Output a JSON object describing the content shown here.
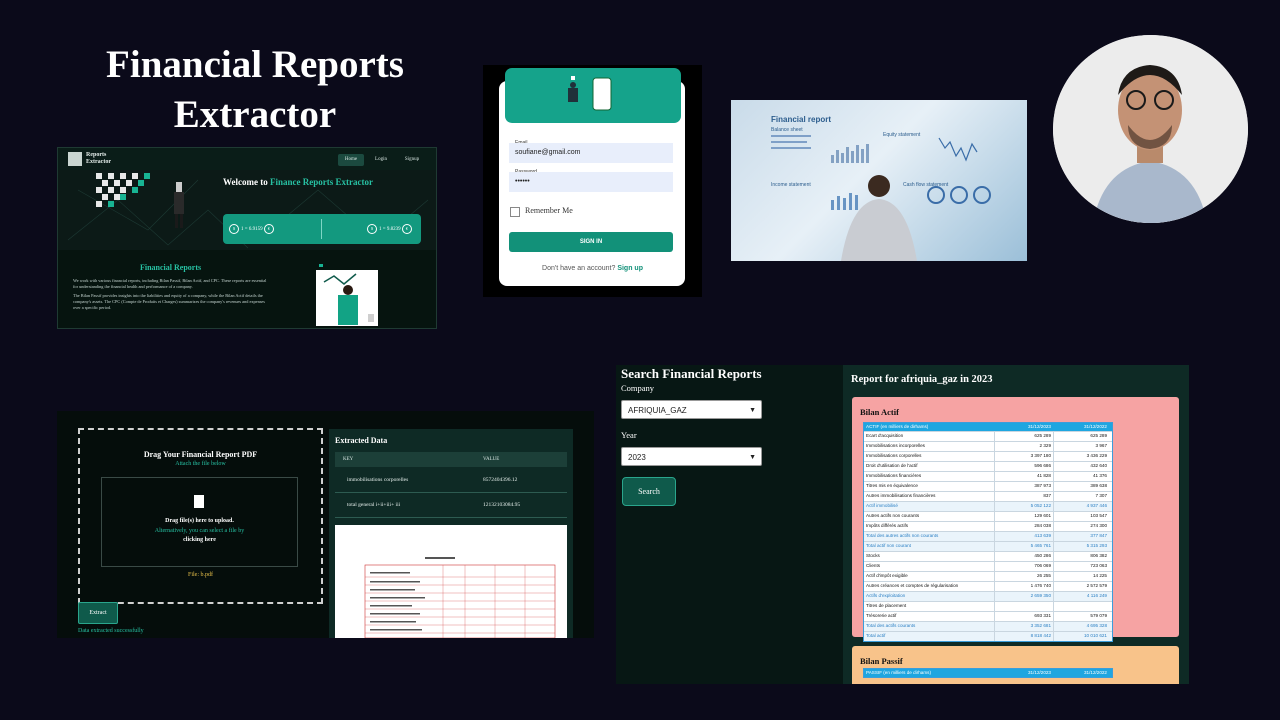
{
  "title_line1": "Financial Reports",
  "title_line2": "Extractor",
  "landing": {
    "brand_line1": "Reports",
    "brand_line2": "Extractor",
    "nav": [
      "Home",
      "Login",
      "Signup"
    ],
    "welcome_prefix": "Welcome to",
    "welcome_brand": "Finance Reports Extractor",
    "rate1": "1 = 6.9159",
    "rate2": "1 = 9.8239",
    "rate1_symbol": "$",
    "rate1_symbol2": "€",
    "rate2_symbol": "$",
    "rate2_symbol2": "€",
    "section_title": "Financial Reports",
    "para1": "We work with various financial reports, including Bilan Passif, Bilan Actif, and CPC. These reports are essential for understanding the financial health and performance of a company.",
    "para2": "The Bilan Passif provides insights into the liabilities and equity of a company, while the Bilan Actif details the company's assets. The CPC (Compte de Produits et Charges) summarizes the company's revenues and expenses over a specific period."
  },
  "login": {
    "email_label": "Email",
    "email_value": "soufiane@gmail.com",
    "password_label": "Password",
    "password_value": "••••••",
    "remember": "Remember Me",
    "sign_in": "SIGN IN",
    "no_account": "Don't have an account?",
    "sign_up": "Sign up"
  },
  "photo": {
    "report_title": "Financial report",
    "balance_sheet": "Balance sheet",
    "equity_statement": "Equity statement",
    "income_statement": "Income statement",
    "cash_flow": "Cash flow statement"
  },
  "extract": {
    "drag_title": "Drag Your Financial Report PDF",
    "attach": "Attach the file below",
    "drag1": "Drag file(s) here to upload.",
    "drag2": "Alternatively, you can select a file by",
    "drag3": "clicking here",
    "file": "File: b.pdf",
    "extract_btn": "Extract",
    "success": "Data extracted successfully",
    "panel_title": "Extracted Data",
    "col_key": "KEY",
    "col_value": "VALUE",
    "rows": [
      {
        "key": "immobilisations corporelles",
        "value": "8572404396.12"
      },
      {
        "key": "total general i+ii+iii+ iii",
        "value": "12132103084.95"
      }
    ]
  },
  "search": {
    "title": "Search Financial Reports",
    "company_label": "Company",
    "company_value": "AFRIQUIA_GAZ",
    "year_label": "Year",
    "year_value": "2023",
    "button": "Search"
  },
  "report": {
    "title": "Report for afriquia_gaz in 2023",
    "actif_title": "Bilan Actif",
    "actif_header": [
      "ACTIF (en milliers de dirhams)",
      "31/12/2023",
      "31/12/2022"
    ],
    "actif_rows": [
      {
        "label": "Ecart d'acquisition",
        "y2023": "625 289",
        "y2022": "625 289",
        "hl": false
      },
      {
        "label": "Immobilisations incorporelles",
        "y2023": "2 329",
        "y2022": "3 967",
        "hl": false
      },
      {
        "label": "Immobilisations corporelles",
        "y2023": "3 397 180",
        "y2022": "3 436 229",
        "hl": false
      },
      {
        "label": "Droit d'utilisation de l'actif",
        "y2023": "596 686",
        "y2022": "432 640",
        "hl": false
      },
      {
        "label": "Immobilisations financières",
        "y2023": "41 828",
        "y2022": "41 376",
        "hl": false
      },
      {
        "label": "Titres mis en équivalence",
        "y2023": "387 973",
        "y2022": "389 638",
        "hl": false
      },
      {
        "label": "Autres immobilisations financières",
        "y2023": "837",
        "y2022": "7 307",
        "hl": false
      },
      {
        "label": "Actif immobilisé",
        "y2023": "5 052 122",
        "y2022": "4 937 446",
        "hl": true
      },
      {
        "label": "Autres actifs non courants",
        "y2023": "129 601",
        "y2022": "103 547",
        "hl": false
      },
      {
        "label": "Impôts différés actifs",
        "y2023": "284 038",
        "y2022": "274 300",
        "hl": false
      },
      {
        "label": "Total des autres actifs non courants",
        "y2023": "413 639",
        "y2022": "377 847",
        "hl": true
      },
      {
        "label": "Total actif non courant",
        "y2023": "5 465 761",
        "y2022": "5 315 293",
        "hl": true
      },
      {
        "label": "Stocks",
        "y2023": "450 286",
        "y2022": "806 382",
        "hl": false
      },
      {
        "label": "Clients",
        "y2023": "706 069",
        "y2022": "723 063",
        "hl": false
      },
      {
        "label": "Actif d'impôt exigible",
        "y2023": "26 255",
        "y2022": "14 225",
        "hl": false
      },
      {
        "label": "Autres créances et comptes de régularisation",
        "y2023": "1 476 740",
        "y2022": "2 572 579",
        "hl": false
      },
      {
        "label": "Actifs d'exploitation",
        "y2023": "2 659 350",
        "y2022": "4 116 249",
        "hl": true
      },
      {
        "label": "Titres de placement",
        "y2023": "",
        "y2022": "",
        "hl": false
      },
      {
        "label": "Trésorerie actif",
        "y2023": "693 331",
        "y2022": "579 079",
        "hl": false
      },
      {
        "label": "Total des actifs courants",
        "y2023": "3 352 681",
        "y2022": "4 695 328",
        "hl": true
      },
      {
        "label": "Total actif",
        "y2023": "8 818 442",
        "y2022": "10 010 621",
        "hl": true
      }
    ],
    "passif_title": "Bilan Passif",
    "passif_header": [
      "PASSIF (en milliers de dirhams)",
      "31/12/2023",
      "31/12/2022"
    ]
  }
}
